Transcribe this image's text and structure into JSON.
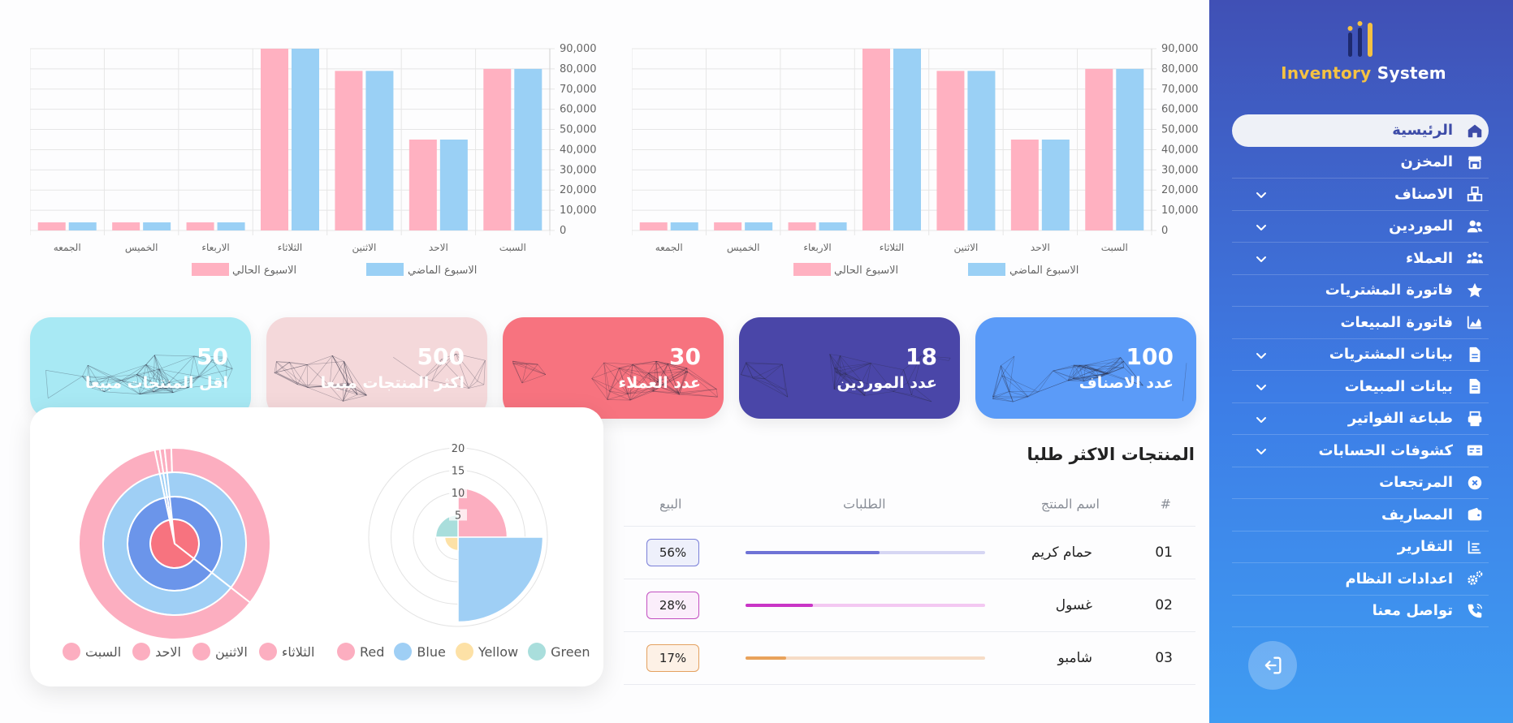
{
  "app": {
    "logo_text_1": "Inventory",
    "logo_text_2": " System"
  },
  "sidebar": {
    "items": [
      {
        "label": "الرئيسية",
        "icon": "home-icon",
        "active": true,
        "expandable": false
      },
      {
        "label": "المخزن",
        "icon": "store-icon",
        "active": false,
        "expandable": false
      },
      {
        "label": "الاصناف",
        "icon": "boxes-icon",
        "active": false,
        "expandable": true
      },
      {
        "label": "الموردين",
        "icon": "users-icon",
        "active": false,
        "expandable": true
      },
      {
        "label": "العملاء",
        "icon": "user-group-icon",
        "active": false,
        "expandable": true
      },
      {
        "label": "فاتورة المشتريات",
        "icon": "star-icon",
        "active": false,
        "expandable": false
      },
      {
        "label": "فاتورة المبيعات",
        "icon": "chart-area-icon",
        "active": false,
        "expandable": false
      },
      {
        "label": "بيانات المشتريات",
        "icon": "file-icon",
        "active": false,
        "expandable": true
      },
      {
        "label": "بيانات المبيعات",
        "icon": "file-icon",
        "active": false,
        "expandable": true
      },
      {
        "label": "طباعة الفواتير",
        "icon": "printer-icon",
        "active": false,
        "expandable": true
      },
      {
        "label": "كشوفات الحسابات",
        "icon": "card-icon",
        "active": false,
        "expandable": true
      },
      {
        "label": "المرتجعات",
        "icon": "x-circle-icon",
        "active": false,
        "expandable": false
      },
      {
        "label": "المصاريف",
        "icon": "wallet-icon",
        "active": false,
        "expandable": false
      },
      {
        "label": "التقارير",
        "icon": "list-icon",
        "active": false,
        "expandable": false
      },
      {
        "label": "اعدادات النظام",
        "icon": "gears-icon",
        "active": false,
        "expandable": false
      },
      {
        "label": "تواصل معنا",
        "icon": "phone-icon",
        "active": false,
        "expandable": false
      }
    ],
    "logout_icon": "logout-icon"
  },
  "stats": [
    {
      "value": "100",
      "label": "عدد الاصناف",
      "color": "#5b9bf8"
    },
    {
      "value": "18",
      "label": "عدد الموردين",
      "color": "#4a46a8"
    },
    {
      "value": "30",
      "label": "عدد العملاء",
      "color": "#f7737f"
    },
    {
      "value": "500",
      "label": "اكثر المنتجات مبيعا",
      "color": "#f4d8da"
    },
    {
      "value": "50",
      "label": "اقل المنتجات مبيعا",
      "color": "#a8e9f4"
    }
  ],
  "table": {
    "title": "المنتجات الاكثر طلبا",
    "headers": {
      "num": "#",
      "name": "اسم المنتج",
      "orders": "الطلبات",
      "sales": "البيع"
    },
    "rows": [
      {
        "num": "01",
        "name": "حمام كريم",
        "progress": 0.56,
        "percent": "56%",
        "color": "#6f73d6",
        "track": "#d6d6f3",
        "badge_bg": "#eef0fb",
        "badge_border": "#7a7fd8"
      },
      {
        "num": "02",
        "name": "غسول",
        "progress": 0.28,
        "percent": "28%",
        "color": "#c935c6",
        "track": "#f3c8f2",
        "badge_bg": "#fbeefb",
        "badge_border": "#c24fc1"
      },
      {
        "num": "03",
        "name": "شامبو",
        "progress": 0.17,
        "percent": "17%",
        "color": "#e9a25b",
        "track": "#f6dcc6",
        "badge_bg": "#fdf1e6",
        "badge_border": "#e4a160"
      }
    ]
  },
  "polar_legend": [
    {
      "label": "Red",
      "color": "#fcaec0"
    },
    {
      "label": "Blue",
      "color": "#9fcff5"
    },
    {
      "label": "Yellow",
      "color": "#fde1a6"
    },
    {
      "label": "Green",
      "color": "#a9dedc"
    }
  ],
  "donut_legend": [
    {
      "label": "السبت",
      "color": "#fcaec0"
    },
    {
      "label": "الاحد",
      "color": "#fcaec0"
    },
    {
      "label": "الاثنين",
      "color": "#fcaec0"
    },
    {
      "label": "الثلاثاء",
      "color": "#fcaec0"
    }
  ],
  "chart_data": [
    {
      "type": "bar",
      "categories": [
        "الجمعه",
        "الخميس",
        "الاربعاء",
        "الثلاثاء",
        "الاثنين",
        "الاحد",
        "السبت"
      ],
      "series": [
        {
          "name": "الاسبوع الحالي",
          "values": [
            4000,
            4000,
            4000,
            90000,
            79000,
            45000,
            80000
          ],
          "color": "#ffb1c1"
        },
        {
          "name": "الاسبوع الماضي",
          "values": [
            4000,
            4000,
            4000,
            90000,
            79000,
            45000,
            80000
          ],
          "color": "#9ad0f5"
        }
      ],
      "ylim": [
        0,
        90000
      ],
      "yticks": [
        "0",
        "10,000",
        "20,000",
        "30,000",
        "40,000",
        "50,000",
        "60,000",
        "70,000",
        "80,000",
        "90,000"
      ],
      "legend": "bottom"
    },
    {
      "type": "bar",
      "categories": [
        "الجمعه",
        "الخميس",
        "الاربعاء",
        "الثلاثاء",
        "الاثنين",
        "الاحد",
        "السبت"
      ],
      "series": [
        {
          "name": "الاسبوع الحالي",
          "values": [
            4000,
            4000,
            4000,
            90000,
            79000,
            45000,
            80000
          ],
          "color": "#ffb1c1"
        },
        {
          "name": "الاسبوع الماضي",
          "values": [
            4000,
            4000,
            4000,
            90000,
            79000,
            45000,
            80000
          ],
          "color": "#9ad0f5"
        }
      ],
      "ylim": [
        0,
        90000
      ],
      "yticks": [
        "0",
        "10,000",
        "20,000",
        "30,000",
        "40,000",
        "50,000",
        "60,000",
        "70,000",
        "80,000",
        "90,000"
      ],
      "legend": "bottom"
    },
    {
      "type": "polarArea",
      "categories": [
        "Red",
        "Blue",
        "Yellow",
        "Green"
      ],
      "values": [
        11,
        19,
        3,
        5
      ],
      "rticks": [
        "5",
        "10",
        "15",
        "20"
      ],
      "rmax": 20
    },
    {
      "type": "doughnut",
      "categories": [
        "السبت",
        "الاحد",
        "الاثنين",
        "الثلاثاء"
      ]
    }
  ]
}
